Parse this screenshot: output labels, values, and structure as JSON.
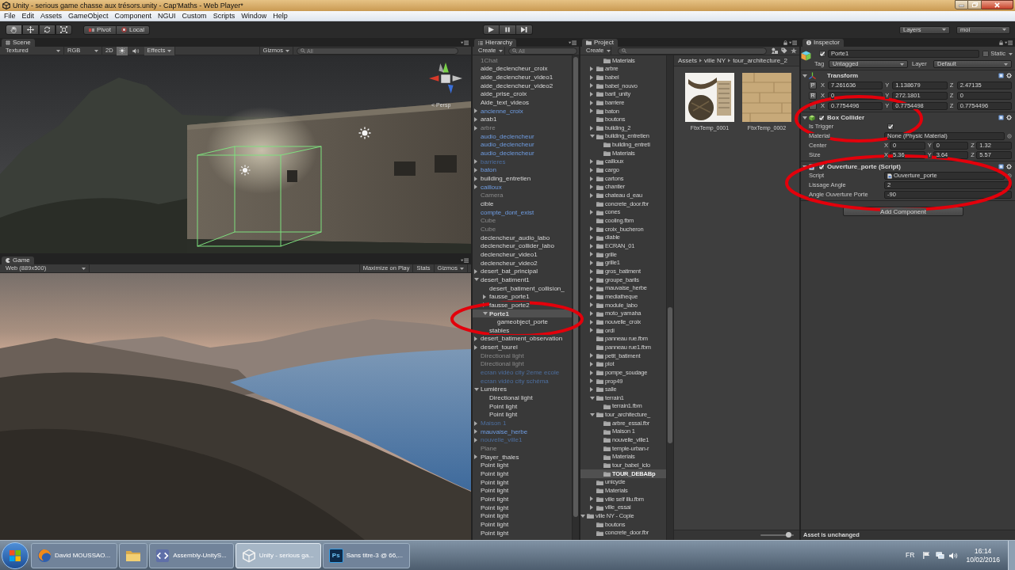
{
  "window": {
    "title": "Unity - serious game chasse aux trésors.unity - Cap'Maths - Web Player*"
  },
  "menu": [
    "File",
    "Edit",
    "Assets",
    "GameObject",
    "Component",
    "NGUI",
    "Custom",
    "Scripts",
    "Window",
    "Help"
  ],
  "toolbar": {
    "tools": [
      {
        "kind": "hand",
        "selected": true
      },
      {
        "kind": "move",
        "selected": false
      },
      {
        "kind": "rotate",
        "selected": false
      },
      {
        "kind": "scale",
        "selected": false
      }
    ],
    "pivot": "Pivot",
    "space": "Local",
    "layers": "Layers",
    "layout": "moi"
  },
  "scene": {
    "tab": "Scene",
    "draw_mode": "Textured",
    "render_mode": "RGB",
    "mode_2d": "2D",
    "lighting": true,
    "audio": false,
    "effects": "Effects",
    "gizmos": "Gizmos",
    "search": {
      "placeholder": "All"
    },
    "projection": "< Persp"
  },
  "game": {
    "tab": "Game",
    "aspect": "Web (889x500)",
    "maximize": "Maximize on Play",
    "stats": "Stats",
    "gizmos": "Gizmos"
  },
  "hierarchy": {
    "tab": "Hierarchy",
    "create": "Create",
    "search": {
      "placeholder": "All"
    },
    "items": [
      {
        "name": "1Chat",
        "prefab": false,
        "active": false,
        "selected": false
      },
      {
        "name": "aide_declencheur_croix",
        "prefab": false,
        "active": true,
        "selected": false
      },
      {
        "name": "aide_declencheur_video1",
        "prefab": false,
        "active": true,
        "selected": false
      },
      {
        "name": "aide_declencheur_video2",
        "prefab": false,
        "active": true,
        "selected": false
      },
      {
        "name": "aide_prise_croix",
        "prefab": false,
        "active": true,
        "selected": false
      },
      {
        "name": "Aide_text_videos",
        "prefab": false,
        "active": true,
        "selected": false
      },
      {
        "name": "ancienne_croix",
        "prefab": true,
        "active": true,
        "selected": false,
        "expanded": false
      },
      {
        "name": "arab1",
        "prefab": false,
        "active": true,
        "selected": false,
        "expanded": false
      },
      {
        "name": "arbre",
        "prefab": false,
        "active": false,
        "selected": false,
        "expanded": false
      },
      {
        "name": "audio_declencheur",
        "prefab": true,
        "active": true,
        "selected": false
      },
      {
        "name": "audio_declencheur",
        "prefab": true,
        "active": true,
        "selected": false
      },
      {
        "name": "audio_declencheur",
        "prefab": true,
        "active": true,
        "selected": false
      },
      {
        "name": "barrieres",
        "prefab": true,
        "active": false,
        "selected": false,
        "expanded": false
      },
      {
        "name": "baton",
        "prefab": true,
        "active": true,
        "selected": false,
        "expanded": false
      },
      {
        "name": "building_entretien",
        "prefab": false,
        "active": true,
        "selected": false,
        "expanded": false
      },
      {
        "name": "cailloux",
        "prefab": true,
        "active": true,
        "selected": false,
        "expanded": false
      },
      {
        "name": "Camera",
        "prefab": false,
        "active": false,
        "selected": false
      },
      {
        "name": "cible",
        "prefab": false,
        "active": true,
        "selected": false
      },
      {
        "name": "compte_dont_exist",
        "prefab": true,
        "active": true,
        "selected": false
      },
      {
        "name": "Cube",
        "prefab": false,
        "active": false,
        "selected": false
      },
      {
        "name": "Cube",
        "prefab": false,
        "active": false,
        "selected": false
      },
      {
        "name": "declencheur_audio_labo",
        "prefab": false,
        "active": true,
        "selected": false
      },
      {
        "name": "declencheur_collider_labo",
        "prefab": false,
        "active": true,
        "selected": false
      },
      {
        "name": "declencheur_video1",
        "prefab": false,
        "active": true,
        "selected": false
      },
      {
        "name": "declencheur_video2",
        "prefab": false,
        "active": true,
        "selected": false
      },
      {
        "name": "desert_bat_principal",
        "prefab": false,
        "active": true,
        "selected": false,
        "expanded": false
      },
      {
        "name": "desert_batiment1",
        "prefab": false,
        "active": true,
        "selected": false,
        "expanded": true,
        "children": [
          {
            "name": "desert_batiment_collision_",
            "prefab": false,
            "active": true,
            "selected": false
          },
          {
            "name": "fausse_porte1",
            "prefab": false,
            "active": true,
            "selected": false,
            "expanded": false
          },
          {
            "name": "fausse_porte2",
            "prefab": false,
            "active": true,
            "selected": false,
            "expanded": false
          },
          {
            "name": "Porte1",
            "prefab": false,
            "active": true,
            "selected": true,
            "expanded": true,
            "children": [
              {
                "name": "gameobject_porte",
                "prefab": false,
                "active": true,
                "selected": false
              }
            ]
          },
          {
            "name": "stables",
            "prefab": false,
            "active": true,
            "selected": false
          }
        ]
      },
      {
        "name": "desert_batiment_observation",
        "prefab": false,
        "active": true,
        "selected": false,
        "expanded": false
      },
      {
        "name": "desert_tourel",
        "prefab": false,
        "active": true,
        "selected": false,
        "expanded": false
      },
      {
        "name": "Directional light",
        "prefab": false,
        "active": false,
        "selected": false
      },
      {
        "name": "Directional light",
        "prefab": false,
        "active": false,
        "selected": false
      },
      {
        "name": "ecran vidéo city 2eme ecole",
        "prefab": true,
        "active": false,
        "selected": false
      },
      {
        "name": "ecran vidéo city schéma",
        "prefab": true,
        "active": false,
        "selected": false
      },
      {
        "name": "Lumières",
        "prefab": false,
        "active": true,
        "selected": false,
        "expanded": true,
        "children": [
          {
            "name": "Directional light",
            "prefab": false,
            "active": true,
            "selected": false
          },
          {
            "name": "Point light",
            "prefab": false,
            "active": true,
            "selected": false
          },
          {
            "name": "Point light",
            "prefab": false,
            "active": true,
            "selected": false
          }
        ]
      },
      {
        "name": "Maison 1",
        "prefab": true,
        "active": false,
        "selected": false,
        "expanded": false
      },
      {
        "name": "mauvaise_herbe",
        "prefab": true,
        "active": true,
        "selected": false,
        "expanded": false
      },
      {
        "name": "nouvelle_ville1",
        "prefab": true,
        "active": false,
        "selected": false,
        "expanded": false
      },
      {
        "name": "Plane",
        "prefab": false,
        "active": false,
        "selected": false
      },
      {
        "name": "Player_thales",
        "prefab": false,
        "active": true,
        "selected": false,
        "expanded": false
      },
      {
        "name": "Point light",
        "prefab": false,
        "active": true,
        "selected": false
      },
      {
        "name": "Point light",
        "prefab": false,
        "active": true,
        "selected": false
      },
      {
        "name": "Point light",
        "prefab": false,
        "active": true,
        "selected": false
      },
      {
        "name": "Point light",
        "prefab": false,
        "active": true,
        "selected": false
      },
      {
        "name": "Point light",
        "prefab": false,
        "active": true,
        "selected": false
      },
      {
        "name": "Point light",
        "prefab": false,
        "active": true,
        "selected": false
      },
      {
        "name": "Point light",
        "prefab": false,
        "active": true,
        "selected": false
      },
      {
        "name": "Point light",
        "prefab": false,
        "active": true,
        "selected": false
      },
      {
        "name": "Point light",
        "prefab": false,
        "active": true,
        "selected": false
      }
    ]
  },
  "project": {
    "tab": "Project",
    "create": "Create",
    "tree": [
      {
        "children": [
          {
            "children": [
              {
                "name": "Materials",
                "selected": false
              }
            ]
          },
          {
            "name": "arbre",
            "selected": false,
            "expanded": false
          },
          {
            "name": "babel",
            "selected": false,
            "expanded": false
          },
          {
            "name": "babel_nouvo",
            "selected": false,
            "expanded": false
          },
          {
            "name": "baril_unity",
            "selected": false,
            "expanded": false
          },
          {
            "name": "barriere",
            "selected": false,
            "expanded": false
          },
          {
            "name": "baton",
            "selected": false,
            "expanded": false
          },
          {
            "name": "boutons",
            "selected": false
          },
          {
            "name": "building_2",
            "selected": false,
            "expanded": false
          },
          {
            "name": "building_entretien",
            "selected": false,
            "expanded": true,
            "children": [
              {
                "name": "building_entreti",
                "selected": false
              },
              {
                "name": "Materials",
                "selected": false
              }
            ]
          },
          {
            "name": "cailloux",
            "selected": false,
            "expanded": false
          },
          {
            "name": "cargo",
            "selected": false,
            "expanded": false
          },
          {
            "name": "cartons",
            "selected": false,
            "expanded": false
          },
          {
            "name": "chantier",
            "selected": false,
            "expanded": false
          },
          {
            "name": "chateau d_eau",
            "selected": false,
            "expanded": false
          },
          {
            "name": "concrete_door.fbr",
            "selected": false
          },
          {
            "name": "cones",
            "selected": false,
            "expanded": false
          },
          {
            "name": "cooling.fbm",
            "selected": false
          },
          {
            "name": "croix_bucheron",
            "selected": false,
            "expanded": false
          },
          {
            "name": "diable",
            "selected": false,
            "expanded": false
          },
          {
            "name": "ECRAN_01",
            "selected": false,
            "expanded": false
          },
          {
            "name": "grille",
            "selected": false,
            "expanded": false
          },
          {
            "name": "grille1",
            "selected": false,
            "expanded": false
          },
          {
            "name": "gros_batiment",
            "selected": false,
            "expanded": false
          },
          {
            "name": "groupe_barils",
            "selected": false,
            "expanded": false
          },
          {
            "name": "mauvaise_herbe",
            "selected": false,
            "expanded": false
          },
          {
            "name": "mediatheque",
            "selected": false,
            "expanded": false
          },
          {
            "name": "module_labo",
            "selected": false,
            "expanded": false
          },
          {
            "name": "moto_yamaha",
            "selected": false,
            "expanded": false
          },
          {
            "name": "nouvelle_croix",
            "selected": false,
            "expanded": false
          },
          {
            "name": "ordi",
            "selected": false,
            "expanded": false
          },
          {
            "name": "panneau rue.fbm",
            "selected": false
          },
          {
            "name": "panneau rue1.fbm",
            "selected": false
          },
          {
            "name": "petit_batiment",
            "selected": false,
            "expanded": false
          },
          {
            "name": "plot",
            "selected": false,
            "expanded": false
          },
          {
            "name": "pompe_soudage",
            "selected": false,
            "expanded": false
          },
          {
            "name": "prop49",
            "selected": false,
            "expanded": false
          },
          {
            "name": "salle",
            "selected": false,
            "expanded": false
          },
          {
            "name": "terrain1",
            "selected": false,
            "expanded": true,
            "children": [
              {
                "name": "terrain1.fbm",
                "selected": false
              }
            ]
          },
          {
            "name": "tour_architecture_",
            "selected": false,
            "expanded": true,
            "children": [
              {
                "name": "arbre_essai.fbr",
                "selected": false
              },
              {
                "name": "Maison 1",
                "selected": false
              },
              {
                "name": "nouvelle_ville1",
                "selected": false
              },
              {
                "name": "temple-urban-r",
                "selected": false
              },
              {
                "name": "Materials",
                "selected": false
              },
              {
                "name": "tour_babel_iclo",
                "selected": false
              },
              {
                "name": "TOUR_DEBABp",
                "selected": true
              }
            ]
          },
          {
            "name": "unicycle",
            "selected": false
          },
          {
            "name": "Materials",
            "selected": false
          },
          {
            "name": "ville self illu.fbm",
            "selected": false,
            "expanded": false
          },
          {
            "name": "ville_essai",
            "selected": false,
            "expanded": false
          }
        ]
      },
      {
        "name": "ville NY - Copie",
        "selected": false,
        "expanded": true,
        "children": [
          {
            "name": "boutons",
            "selected": false
          },
          {
            "name": "concrete_door.fbr",
            "selected": false
          }
        ]
      }
    ],
    "breadcrumb": [
      "Assets",
      "ville NY",
      "tour_architecture_2"
    ],
    "assets": [
      {
        "name": "FbxTemp_0001",
        "kind": "atlas"
      },
      {
        "name": "FbxTemp_0002",
        "kind": "wood"
      }
    ],
    "zoom_slider": {
      "level": 0.85
    }
  },
  "inspector": {
    "tab": "Inspector",
    "object": {
      "active": true,
      "name": "Porte1",
      "static": false,
      "static_label": "Static",
      "tag_label": "Tag",
      "tag": "Untagged",
      "layer_label": "Layer",
      "layer": "Default"
    },
    "components": [
      {
        "kind": "transform",
        "title": "Transform",
        "expanded": true,
        "properties": [
          {
            "kind": "vector_button",
            "button": "P",
            "fields": [
              {
                "axis": "X",
                "value": "7.261636"
              },
              {
                "axis": "Y",
                "value": "1.138679"
              },
              {
                "axis": "Z",
                "value": "2.47135"
              }
            ]
          },
          {
            "kind": "vector_button",
            "button": "R",
            "fields": [
              {
                "axis": "X",
                "value": "0"
              },
              {
                "axis": "Y",
                "value": "272.1801"
              },
              {
                "axis": "Z",
                "value": "0"
              }
            ]
          },
          {
            "kind": "vector_button",
            "fields": [
              {
                "axis": "X",
                "value": "0.7754496"
              },
              {
                "axis": "Y",
                "value": "0.7754498"
              },
              {
                "axis": "Z",
                "value": "0.7754496"
              }
            ]
          }
        ]
      },
      {
        "kind": "collider",
        "title": "Box Collider",
        "enabled": true,
        "expanded": true,
        "properties": [
          {
            "kind": "toggle",
            "label": "Is Trigger",
            "checked": true
          },
          {
            "kind": "object",
            "label": "Material",
            "value": "None (Physic Material)"
          },
          {
            "kind": "vector",
            "label": "Center",
            "fields": [
              {
                "axis": "X",
                "value": "0"
              },
              {
                "axis": "Y",
                "value": "0"
              },
              {
                "axis": "Z",
                "value": "1.32"
              }
            ]
          },
          {
            "kind": "vector",
            "label": "Size",
            "fields": [
              {
                "axis": "X",
                "value": "5.36"
              },
              {
                "axis": "Y",
                "value": "3.64"
              },
              {
                "axis": "Z",
                "value": "5.57"
              }
            ]
          }
        ]
      },
      {
        "kind": "script",
        "title": "Ouverture_porte (Script)",
        "enabled": true,
        "expanded": true,
        "properties": [
          {
            "kind": "script",
            "label": "Script",
            "value": "Ouverture_porte"
          },
          {
            "kind": "number",
            "label": "Lissage Angle",
            "value": "2"
          },
          {
            "kind": "number",
            "label": "Angle Ouverture Porte",
            "value": "-90"
          }
        ]
      }
    ],
    "add_button": "Add Component",
    "status": "Asset is unchanged"
  },
  "taskbar": {
    "tasks": [
      {
        "kind": "browser",
        "label": "David MOUSSAO...",
        "selected": false
      },
      {
        "kind": "folder",
        "selected": false
      },
      {
        "kind": "editor",
        "label": "Assembly-UnityS...",
        "selected": false
      },
      {
        "kind": "unity",
        "label": "Unity - serious ga...",
        "selected": true
      },
      {
        "kind": "tile",
        "icon_text": "Ps",
        "label": "Sans titre-3 @ 66,...",
        "selected": false
      }
    ],
    "language": "FR",
    "time": "16:14",
    "date": "10/02/2016"
  },
  "annotations": [
    {
      "kind": "hierarchy"
    },
    {
      "kind": "collider"
    },
    {
      "kind": "script"
    }
  ]
}
